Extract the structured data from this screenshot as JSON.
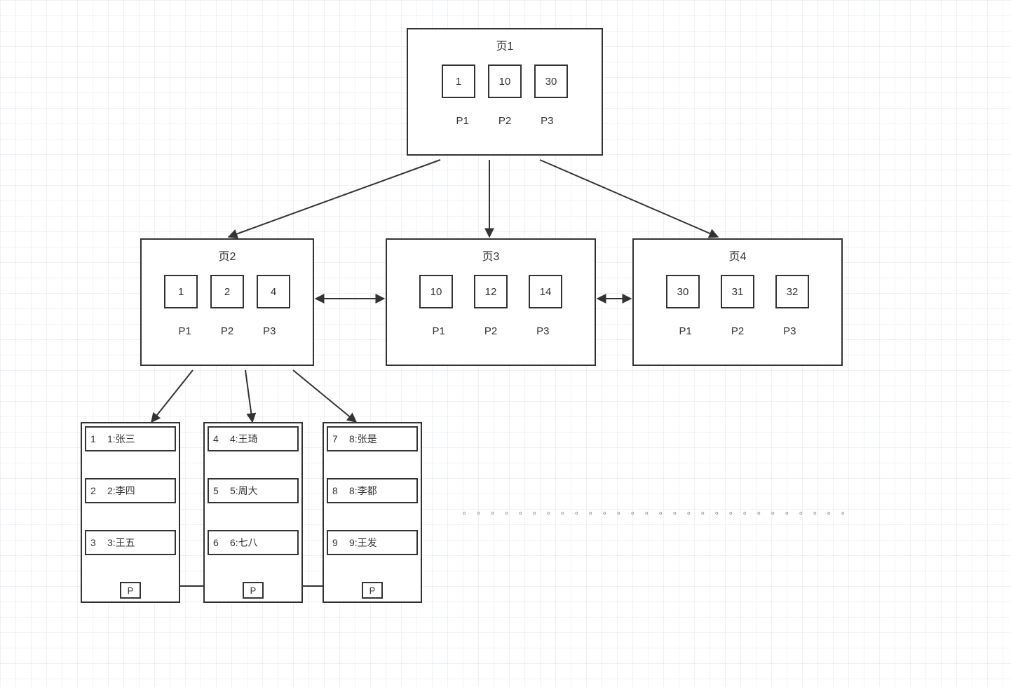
{
  "pages": {
    "p1": {
      "title": "页1",
      "keys": [
        "1",
        "10",
        "30"
      ],
      "ptrs": [
        "P1",
        "P2",
        "P3"
      ]
    },
    "p2": {
      "title": "页2",
      "keys": [
        "1",
        "2",
        "4"
      ],
      "ptrs": [
        "P1",
        "P2",
        "P3"
      ]
    },
    "p3": {
      "title": "页3",
      "keys": [
        "10",
        "12",
        "14"
      ],
      "ptrs": [
        "P1",
        "P2",
        "P3"
      ]
    },
    "p4": {
      "title": "页4",
      "keys": [
        "30",
        "31",
        "32"
      ],
      "ptrs": [
        "P1",
        "P2",
        "P3"
      ]
    }
  },
  "leaves": {
    "l1": {
      "rows": [
        {
          "n": "1",
          "t": "1:张三"
        },
        {
          "n": "2",
          "t": "2:李四"
        },
        {
          "n": "3",
          "t": "3:王五"
        }
      ],
      "p": "P"
    },
    "l2": {
      "rows": [
        {
          "n": "4",
          "t": "4:王琦"
        },
        {
          "n": "5",
          "t": "5:周大"
        },
        {
          "n": "6",
          "t": "6:七八"
        }
      ],
      "p": "P"
    },
    "l3": {
      "rows": [
        {
          "n": "7",
          "t": "8:张是"
        },
        {
          "n": "8",
          "t": "8:李都"
        },
        {
          "n": "9",
          "t": "9:王发"
        }
      ],
      "p": "P"
    }
  },
  "dots": "。。。。。。。。。。。。。。。。。。。。。。。。。。。。"
}
